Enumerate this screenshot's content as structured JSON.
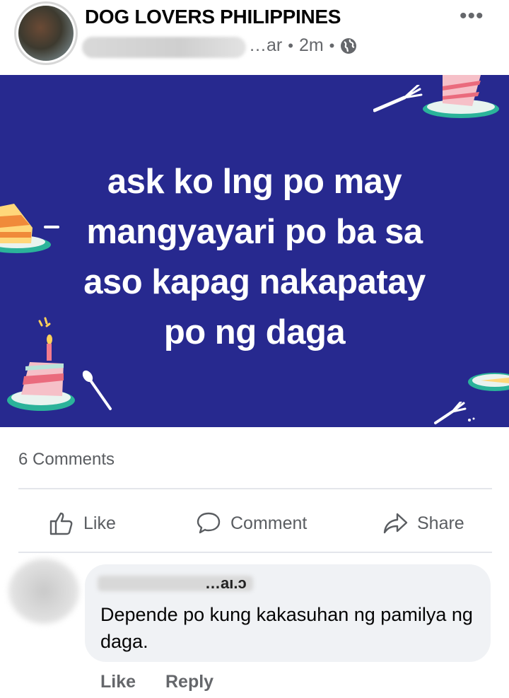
{
  "post": {
    "group_name": "DOG LOVERS PHILIPPINES",
    "author_fragment": "…ar",
    "time": "2m",
    "privacy_icon": "globe-icon",
    "more_icon": "more-options-icon",
    "image_text_lines": [
      "ask ko lng po may",
      "mangyayari po ba sa",
      "aso kapag nakapatay",
      "po ng daga"
    ],
    "image_background": "#27298f"
  },
  "stats": {
    "comments": "6 Comments"
  },
  "actions": {
    "like": "Like",
    "comment": "Comment",
    "share": "Share"
  },
  "comment": {
    "name_fragment": "…aı.ɔ",
    "text": "Depende po kung kakasuhan ng pamilya ng daga.",
    "like": "Like",
    "reply": "Reply"
  }
}
